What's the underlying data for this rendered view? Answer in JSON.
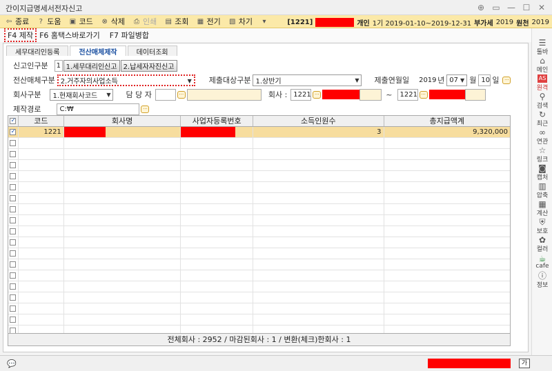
{
  "window": {
    "title": "간이지급명세서전자신고"
  },
  "toolbar": {
    "items": [
      {
        "label": "종료",
        "icon": "exit-icon"
      },
      {
        "label": "도움",
        "icon": "help-icon"
      },
      {
        "label": "코드",
        "icon": "code-icon"
      },
      {
        "label": "삭제",
        "icon": "delete-icon"
      },
      {
        "label": "인쇄",
        "icon": "print-icon"
      },
      {
        "label": "조회",
        "icon": "search-icon"
      },
      {
        "label": "전기",
        "icon": "post-icon"
      },
      {
        "label": "차기",
        "icon": "next-icon"
      }
    ],
    "company_code": "[1221]",
    "type": "개인",
    "period": "1기 2019-01-10~2019-12-31",
    "vat_label": "부가세",
    "vat_year": "2019",
    "withholding_label": "원천",
    "withholding_year": "2019"
  },
  "function_keys": [
    {
      "label": "F4 제작"
    },
    {
      "label": "F6 홈택스바로가기"
    },
    {
      "label": "F7 파일병합"
    }
  ],
  "tabs": [
    {
      "label": "세무대리인등록"
    },
    {
      "label": "전산매체제작"
    },
    {
      "label": "데이터조회"
    }
  ],
  "form": {
    "declarer_label": "신고인구분",
    "declarer_value": "1",
    "declarer_option1": "1.세무대리인신고",
    "declarer_option2": "2.납세자자진신고",
    "media_label": "전산매체구분",
    "media_value": "2.거주자의사업소득",
    "target_label": "제출대상구분",
    "target_value": "1.상반기",
    "submit_ym_label": "제출연월일",
    "year": "2019",
    "year_unit": "년",
    "month": "07",
    "month_unit": "월",
    "day": "10",
    "day_unit": "일",
    "company_type_label": "회사구분",
    "company_type_value": "1.현재회사코드",
    "manager_label": "담 당 자",
    "company_label": "회사 :",
    "company_from": "1221",
    "tilde": "~",
    "company_to": "1221",
    "path_label": "제작경로",
    "path_value": "C:₩"
  },
  "grid": {
    "headers": [
      "코드",
      "회사명",
      "사업자등록번호",
      "소득인원수",
      "총지급액계"
    ],
    "rows": [
      {
        "code": "1221",
        "count": "3",
        "total": "9,320,000"
      }
    ],
    "empty_rows": 18,
    "footer": "전체회사 : 2952 /  마감된회사 : 1 /  변환(체크)한회사 : 1"
  },
  "rightbar": [
    {
      "label": "툴바",
      "icon": "toolbar-icon"
    },
    {
      "label": "메인",
      "icon": "home-icon"
    },
    {
      "label": "원격",
      "icon": "remote-icon"
    },
    {
      "label": "검색",
      "icon": "search-icon"
    },
    {
      "label": "최근",
      "icon": "recent-icon"
    },
    {
      "label": "연관",
      "icon": "link-icon"
    },
    {
      "label": "링크",
      "icon": "star-icon"
    },
    {
      "label": "캡처",
      "icon": "camera-icon"
    },
    {
      "label": "압축",
      "icon": "zip-icon"
    },
    {
      "label": "계산",
      "icon": "calculator-icon"
    },
    {
      "label": "보호",
      "icon": "shield-icon"
    },
    {
      "label": "컬러",
      "icon": "palette-icon"
    },
    {
      "label": "cafe",
      "icon": "cafe-icon"
    },
    {
      "label": "정보",
      "icon": "info-icon"
    }
  ],
  "statusbar": {
    "ime": "가"
  },
  "colors": {
    "toolbar_bg": "#fbe9a8",
    "selected_row": "#f7dd9e",
    "accent": "#1a4fa0",
    "redaction": "#ff0000"
  }
}
